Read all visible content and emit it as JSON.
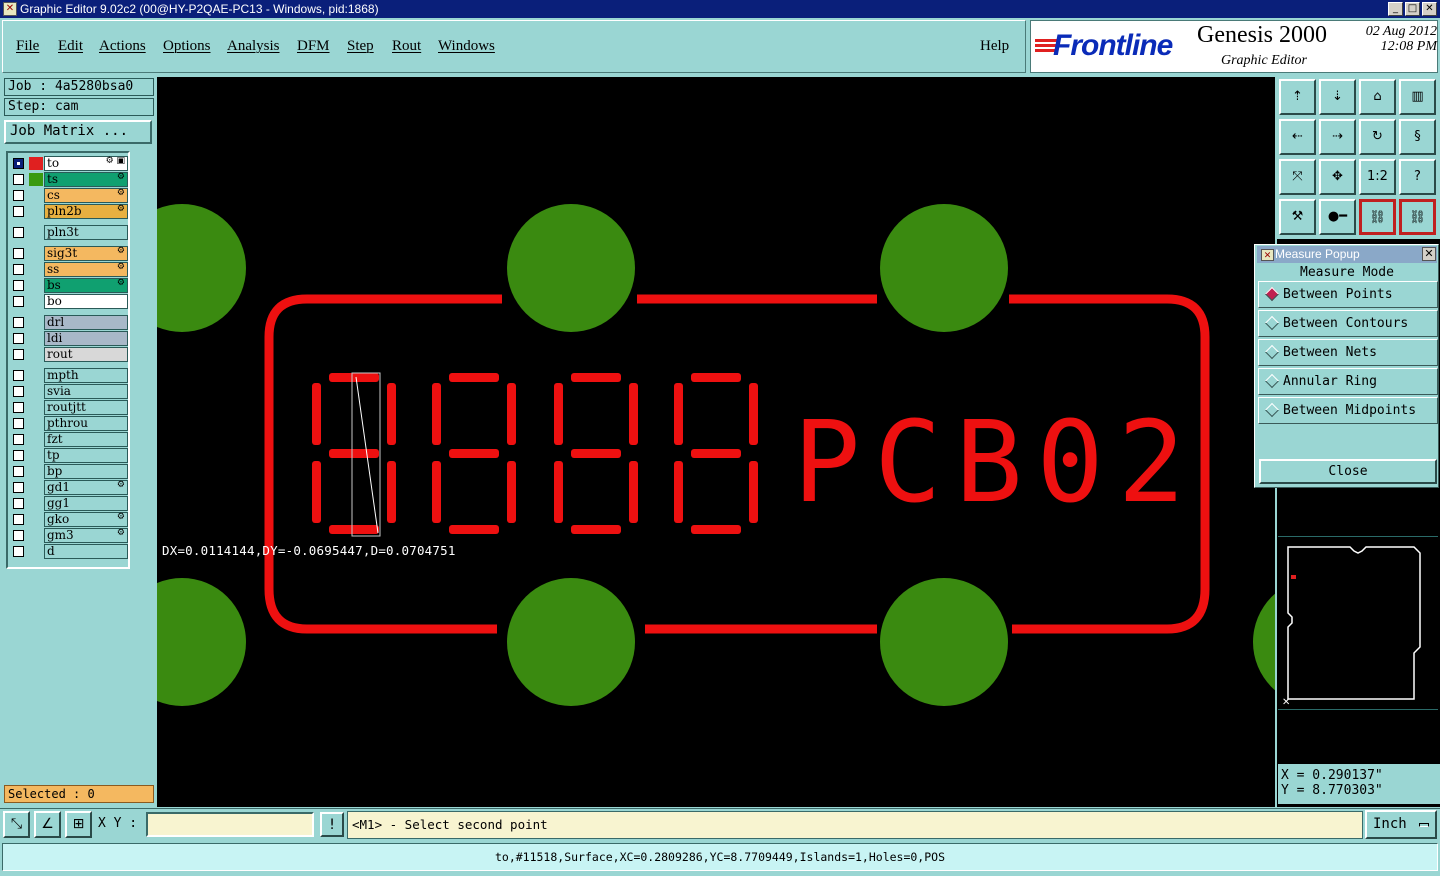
{
  "window": {
    "title": "Graphic Editor 9.02c2 (00@HY-P2QAE-PC13 - Windows, pid:1868)",
    "min": "_",
    "max": "□",
    "close": "✕"
  },
  "menu": [
    "File",
    "Edit",
    "Actions",
    "Options",
    "Analysis",
    "DFM",
    "Step",
    "Rout",
    "Windows"
  ],
  "help": "Help",
  "brand": {
    "logo": "Frontline",
    "product": "Genesis 2000",
    "subtitle": "Graphic Editor",
    "date": "02  Aug 2012",
    "time": "12:08  PM"
  },
  "job": {
    "job": "Job : 4a5280bsa0",
    "step": "Step: cam",
    "matrix_button": "Job Matrix ..."
  },
  "layers": [
    {
      "name": "to",
      "color": "#ffffff",
      "swatch": "#e02020",
      "checked": true,
      "flag": "⚙ ▣"
    },
    {
      "name": "ts",
      "color": "#10a070",
      "swatch": "#3a9a10",
      "checked": false,
      "flag": "⚙"
    },
    {
      "name": "cs",
      "color": "#f4b860",
      "swatch": "",
      "checked": false,
      "flag": "⚙"
    },
    {
      "name": "pln2b",
      "color": "#e8b040",
      "swatch": "",
      "checked": false,
      "flag": "⚙"
    },
    {
      "name": "pln3t",
      "color": "#9ad6d3",
      "swatch": "",
      "checked": false,
      "flag": ""
    },
    {
      "name": "sig3t",
      "color": "#f4b860",
      "swatch": "",
      "checked": false,
      "flag": "⚙"
    },
    {
      "name": "ss",
      "color": "#f4b860",
      "swatch": "",
      "checked": false,
      "flag": "⚙"
    },
    {
      "name": "bs",
      "color": "#10a070",
      "swatch": "",
      "checked": false,
      "flag": "⚙"
    },
    {
      "name": "bo",
      "color": "#ffffff",
      "swatch": "",
      "checked": false,
      "flag": ""
    },
    {
      "name": "drl",
      "color": "#a8b8c8",
      "swatch": "",
      "checked": false,
      "flag": ""
    },
    {
      "name": "ldi",
      "color": "#a8b8c8",
      "swatch": "",
      "checked": false,
      "flag": ""
    },
    {
      "name": "rout",
      "color": "#d8d8d8",
      "swatch": "",
      "checked": false,
      "flag": ""
    },
    {
      "name": "mpth",
      "color": "#9ad6d3",
      "swatch": "",
      "checked": false,
      "flag": ""
    },
    {
      "name": "svia",
      "color": "#9ad6d3",
      "swatch": "",
      "checked": false,
      "flag": ""
    },
    {
      "name": "routjtt",
      "color": "#9ad6d3",
      "swatch": "",
      "checked": false,
      "flag": ""
    },
    {
      "name": "pthrou",
      "color": "#9ad6d3",
      "swatch": "",
      "checked": false,
      "flag": ""
    },
    {
      "name": "fzt",
      "color": "#9ad6d3",
      "swatch": "",
      "checked": false,
      "flag": ""
    },
    {
      "name": "tp",
      "color": "#9ad6d3",
      "swatch": "",
      "checked": false,
      "flag": ""
    },
    {
      "name": "bp",
      "color": "#9ad6d3",
      "swatch": "",
      "checked": false,
      "flag": ""
    },
    {
      "name": "gd1",
      "color": "#9ad6d3",
      "swatch": "",
      "checked": false,
      "flag": "⚙"
    },
    {
      "name": "gg1",
      "color": "#9ad6d3",
      "swatch": "",
      "checked": false,
      "flag": ""
    },
    {
      "name": "gko",
      "color": "#9ad6d3",
      "swatch": "",
      "checked": false,
      "flag": "⚙"
    },
    {
      "name": "gm3",
      "color": "#9ad6d3",
      "swatch": "",
      "checked": false,
      "flag": "⚙"
    },
    {
      "name": "d",
      "color": "#9ad6d3",
      "swatch": "",
      "checked": false,
      "flag": ""
    }
  ],
  "selected": "Selected : 0",
  "canvas": {
    "label": "PCB02",
    "digits": "8888",
    "measure": "DX=0.0114144,DY=-0.0695447,D=0.0704751",
    "pad_color": "#3a8a10",
    "feature_color": "#ee1010"
  },
  "tools": [
    {
      "icon": "move-up-icon",
      "glyph": "⇡"
    },
    {
      "icon": "move-down-icon",
      "glyph": "⇣"
    },
    {
      "icon": "home-icon",
      "glyph": "⌂"
    },
    {
      "icon": "window-split-icon",
      "glyph": "▥"
    },
    {
      "icon": "move-left-icon",
      "glyph": "⇠"
    },
    {
      "icon": "move-right-icon",
      "glyph": "⇢"
    },
    {
      "icon": "rotate-icon",
      "glyph": "↻"
    },
    {
      "icon": "snake-icon",
      "glyph": "§"
    },
    {
      "icon": "fit-screen-icon",
      "glyph": "⤧"
    },
    {
      "icon": "center-icon",
      "glyph": "✥"
    },
    {
      "icon": "scale-icon",
      "glyph": "1:2"
    },
    {
      "icon": "help-icon",
      "glyph": "?"
    },
    {
      "icon": "ruler-tools-icon",
      "glyph": "⚒"
    },
    {
      "icon": "net-point-icon",
      "glyph": "●━"
    },
    {
      "icon": "layer-nets-icon",
      "glyph": "⛓"
    },
    {
      "icon": "layer-nets-alt-icon",
      "glyph": "⛓"
    }
  ],
  "measure_popup": {
    "title": "Measure Popup",
    "heading": "Measure Mode",
    "options": [
      "Between Points",
      "Between Contours",
      "Between Nets",
      "Annular Ring",
      "Between Midpoints"
    ],
    "selected_index": 0,
    "close": "Close"
  },
  "coords": {
    "x": "X = 0.290137\"",
    "y": "Y = 8.770303\""
  },
  "bottom": {
    "xy_label": "X Y :",
    "xy_value": "",
    "bang": "!",
    "prompt": "<M1> - Select second point",
    "unit": "Inch"
  },
  "status": "to,#11518,Surface,XC=0.2809286,YC=8.7709449,Islands=1,Holes=0,POS"
}
